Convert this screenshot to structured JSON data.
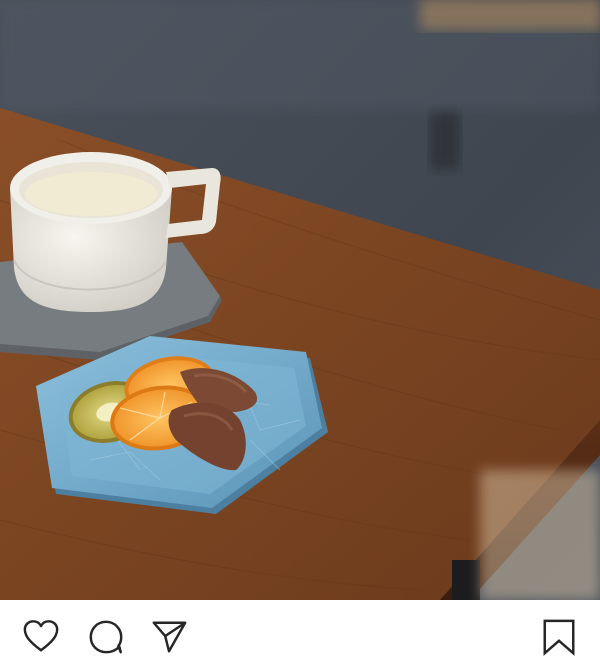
{
  "post": {
    "image_alt": "",
    "subject_icon": "photo-coffee-cup-and-chocolate-dipped-orange-slices"
  },
  "actions": {
    "like_icon": "heart-icon",
    "comment_icon": "speech-bubble-icon",
    "share_icon": "paper-plane-icon",
    "save_icon": "bookmark-icon",
    "icon_color": "#262626"
  },
  "colors": {
    "table_wood": "#7a4522",
    "plate_blue": "#6fa8c8",
    "coaster_gray": "#6f7478",
    "cup_white": "#eeece6",
    "orange": "#f2a33a",
    "kiwi": "#c8c15a",
    "chocolate": "#7a4a36"
  }
}
